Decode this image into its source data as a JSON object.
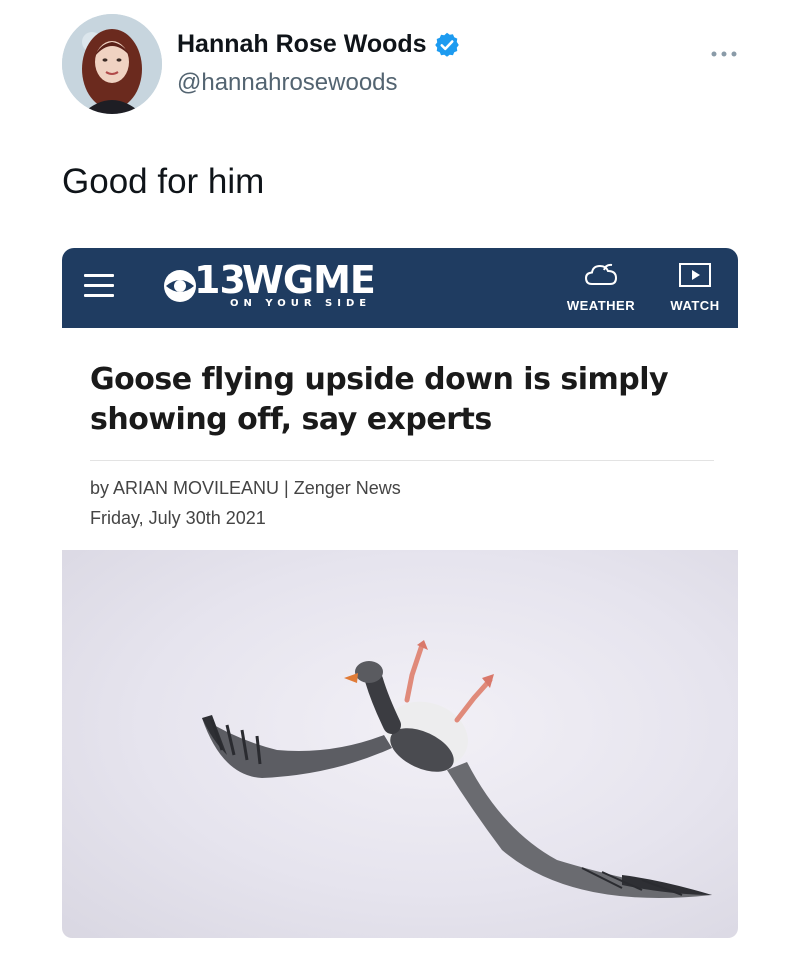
{
  "tweet": {
    "author_name": "Hannah Rose Woods",
    "handle": "@hannahrosewoods",
    "text": "Good for him",
    "more_icon": "more-horizontal-icon",
    "verified_icon": "verified-badge-icon"
  },
  "article_card": {
    "site": {
      "channel_number": "13",
      "name": "WGME",
      "tagline": "ON YOUR SIDE",
      "network_logo": "cbs-eye-icon",
      "menu_icon": "hamburger-menu-icon"
    },
    "nav": {
      "weather_label": "WEATHER",
      "weather_icon": "cloud-icon",
      "watch_label": "WATCH",
      "watch_icon": "play-icon"
    },
    "headline": "Goose flying upside down is simply showing off, say experts",
    "byline": "by ARIAN MOVILEANU | Zenger News",
    "date": "Friday, July 30th 2021",
    "image": "photo of a goose flying upside down"
  },
  "colors": {
    "nav_background": "#1f3c61",
    "verified_blue": "#1d9bf0"
  }
}
